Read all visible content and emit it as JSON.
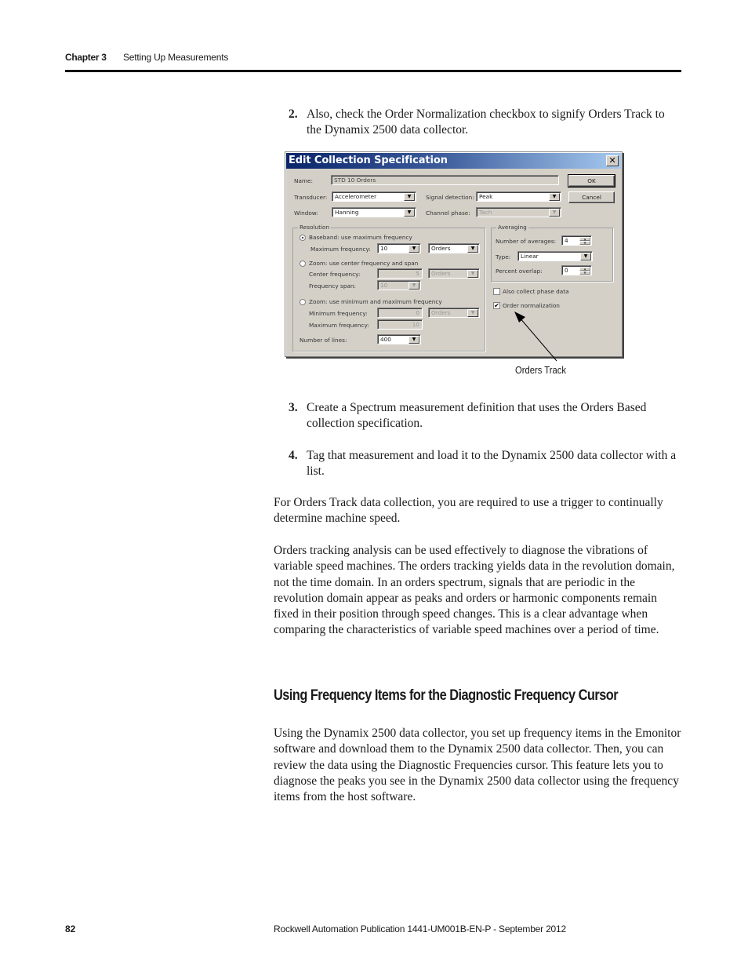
{
  "header": {
    "chapter": "Chapter 3",
    "section_title": "Setting Up Measurements"
  },
  "steps": [
    {
      "number": "2.",
      "text": "Also, check the Order Normalization checkbox to signify Orders Track to the Dynamix 2500 data collector."
    },
    {
      "number": "3.",
      "text": "Create a Spectrum measurement definition that uses the Orders Based collection specification."
    },
    {
      "number": "4.",
      "text": "Tag that measurement and load it to the Dynamix 2500 data collector with a list."
    }
  ],
  "dialog": {
    "title": "Edit Collection Specification",
    "close_glyph": "✕",
    "name_label": "Name:",
    "name_value": "STD 10 Orders",
    "transducer_label": "Transducer:",
    "transducer_value": "Accelerometer",
    "window_label": "Window:",
    "window_value": "Hanning",
    "signal_detection_label": "Signal detection:",
    "signal_detection_value": "Peak",
    "channel_phase_label": "Channel phase:",
    "channel_phase_value": "Tach",
    "ok_label": "OK",
    "cancel_label": "Cancel",
    "resolution": {
      "title": "Resolution",
      "baseband_label": "Baseband: use maximum frequency",
      "baseband_selected": true,
      "max_freq_label": "Maximum frequency:",
      "max_freq_value": "10",
      "max_freq_units": "Orders",
      "zoom_center_label": "Zoom: use center frequency and span",
      "center_freq_label": "Center frequency:",
      "center_freq_value": "5",
      "center_freq_units": "Orders",
      "freq_span_label": "Frequency span:",
      "freq_span_value": "10",
      "zoom_minmax_label": "Zoom: use minimum and maximum frequency",
      "min_freq_label": "Minimum frequency:",
      "min_freq_value": "0",
      "min_freq_units": "Orders",
      "max_freq2_label": "Maximum frequency:",
      "max_freq2_value": "10",
      "lines_label": "Number of lines:",
      "lines_value": "400"
    },
    "averaging": {
      "title": "Averaging",
      "num_averages_label": "Number of averages:",
      "num_averages_value": "4",
      "type_label": "Type:",
      "type_value": "Linear",
      "overlap_label": "Percent overlap:",
      "overlap_value": "0"
    },
    "phase_data_label": "Also collect phase data",
    "phase_data_checked": false,
    "order_norm_label": "Order normalization",
    "order_norm_checked": true,
    "check_glyph": "✔",
    "arrow_glyph": "▼",
    "spin_up": "▲",
    "spin_down": "▼"
  },
  "callout": "Orders Track",
  "paragraphs": [
    "For Orders Track data collection, you are required to use a trigger to continually determine machine speed.",
    "Orders tracking analysis can be used effectively to diagnose the vibrations of variable speed machines. The orders tracking yields data in the revolution domain, not the time domain. In an orders spectrum, signals that are periodic in the revolution domain appear as peaks and orders or harmonic components remain fixed in their position through speed changes. This is a clear advantage when comparing the characteristics of variable speed machines over a period of time."
  ],
  "section_heading": "Using Frequency Items for the Diagnostic Frequency Cursor",
  "section_paragraph": "Using the Dynamix 2500 data collector, you set up frequency items in the Emonitor software and download them to the Dynamix 2500 data collector. Then, you can review the data using the Diagnostic Frequencies cursor. This feature lets you to diagnose the peaks you see in the Dynamix 2500 data collector using the frequency items from the host software.",
  "footer": {
    "page_number": "82",
    "publication": "Rockwell Automation Publication 1441-UM001B-EN-P - September 2012"
  }
}
